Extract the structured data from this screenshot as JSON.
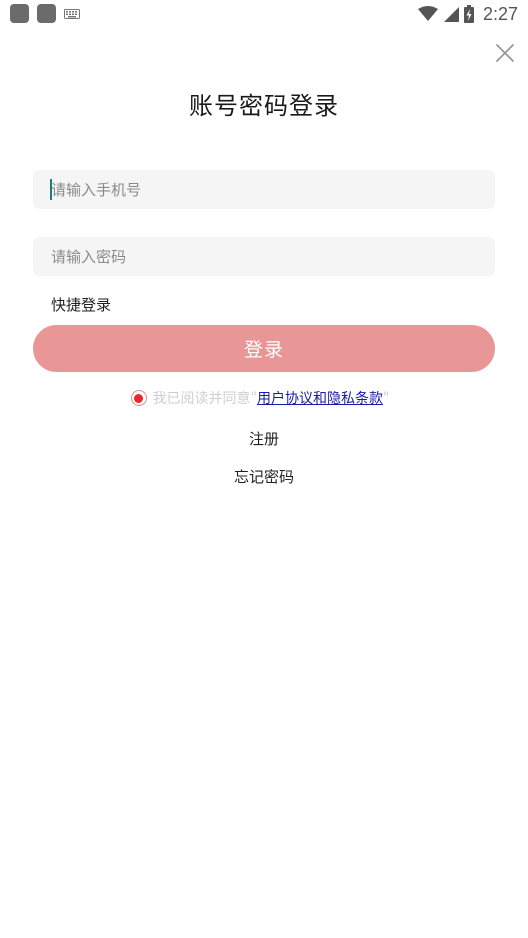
{
  "status_bar": {
    "time": "2:27"
  },
  "title": "账号密码登录",
  "phone_input": {
    "placeholder": "请输入手机号",
    "value": ""
  },
  "password_input": {
    "placeholder": "请输入密码",
    "value": ""
  },
  "quick_login_label": "快捷登录",
  "login_button_label": "登录",
  "agreement": {
    "prefix": "我已阅读并同意",
    "open_quote": "\"",
    "link_text": "用户协议和隐私条款",
    "close_quote": "\"",
    "checked": true
  },
  "register_label": "注册",
  "forgot_password_label": "忘记密码",
  "colors": {
    "login_button": "#e89696",
    "radio_checked": "#e8282a",
    "input_background": "#f5f5f5",
    "link": "#1a1aa8"
  }
}
